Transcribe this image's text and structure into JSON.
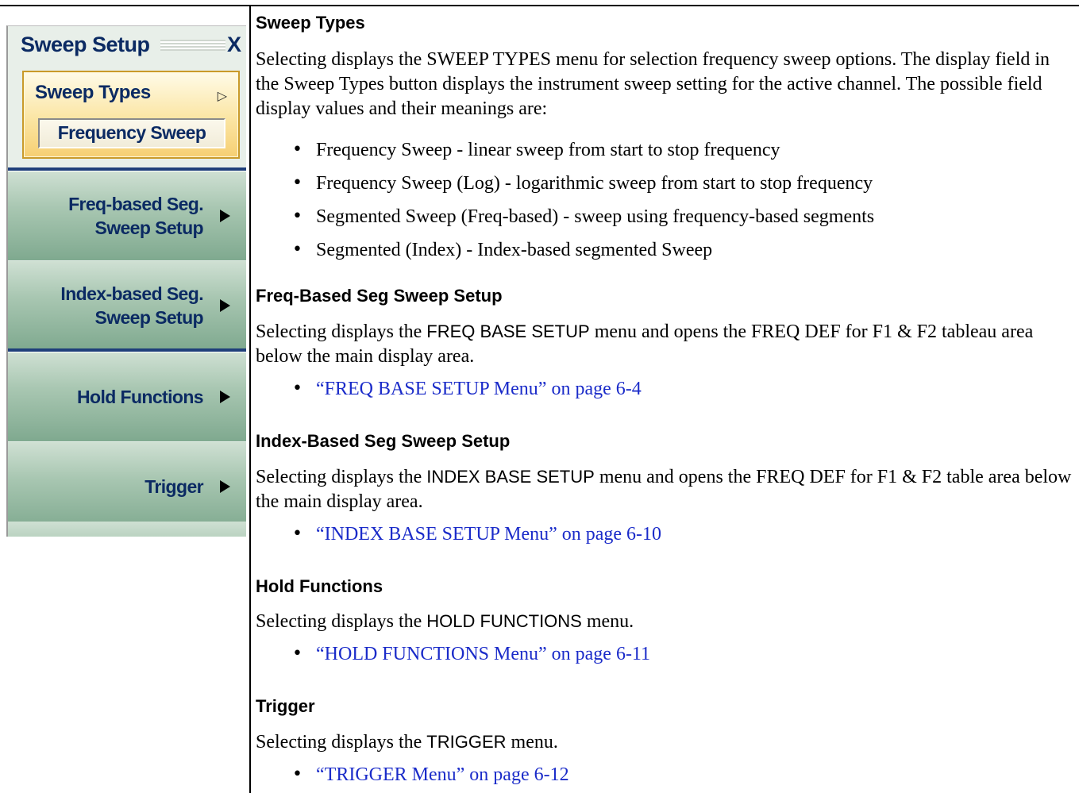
{
  "menu": {
    "title": "Sweep Setup",
    "close_label": "X",
    "sweep_types": {
      "label": "Sweep Types",
      "arrow_glyph": "▷",
      "field_value": "Frequency Sweep"
    },
    "buttons": [
      {
        "line1": "Freq-based Seg.",
        "line2": "Sweep Setup"
      },
      {
        "line1": "Index-based Seg.",
        "line2": "Sweep Setup"
      },
      {
        "line1": "Hold Functions",
        "line2": ""
      },
      {
        "line1": "Trigger",
        "line2": ""
      }
    ]
  },
  "doc": {
    "sweep_types": {
      "heading": "Sweep Types",
      "para": "Selecting displays the SWEEP TYPES menu for selection frequency sweep options. The display field in the Sweep Types button displays the instrument sweep setting for the active channel. The possible field display values and their meanings are:",
      "bullets": [
        "Frequency Sweep - linear sweep from start to stop frequency",
        "Frequency Sweep (Log) - logarithmic sweep from start to stop frequency",
        "Segmented Sweep (Freq-based) - sweep using frequency-based segments",
        "Segmented (Index) - Index-based segmented Sweep"
      ]
    },
    "freq_seg": {
      "heading": "Freq-Based Seg Sweep Setup",
      "para_lead": "Selecting displays the ",
      "para_menu": "FREQ BASE SETUP",
      "para_tail": " menu and opens the FREQ DEF for F1 & F2 tableau area below the main display area.",
      "link": "“FREQ BASE SETUP Menu” on page 6-4"
    },
    "index_seg": {
      "heading": "Index-Based Seg Sweep Setup",
      "para_lead": "Selecting displays the ",
      "para_menu": "INDEX BASE SETUP",
      "para_tail": " menu and opens the FREQ DEF for F1 & F2 table area below the main display area.",
      "link": "“INDEX BASE SETUP Menu” on page 6-10"
    },
    "hold": {
      "heading": "Hold Functions",
      "para_lead": "Selecting displays the ",
      "para_menu": "HOLD FUNCTIONS",
      "para_tail": " menu.",
      "link": "“HOLD FUNCTIONS Menu” on page 6-11"
    },
    "trigger": {
      "heading": "Trigger",
      "para_lead": "Selecting displays the ",
      "para_menu": "TRIGGER",
      "para_tail": " menu.",
      "link": "“TRIGGER Menu” on page 6-12"
    }
  }
}
